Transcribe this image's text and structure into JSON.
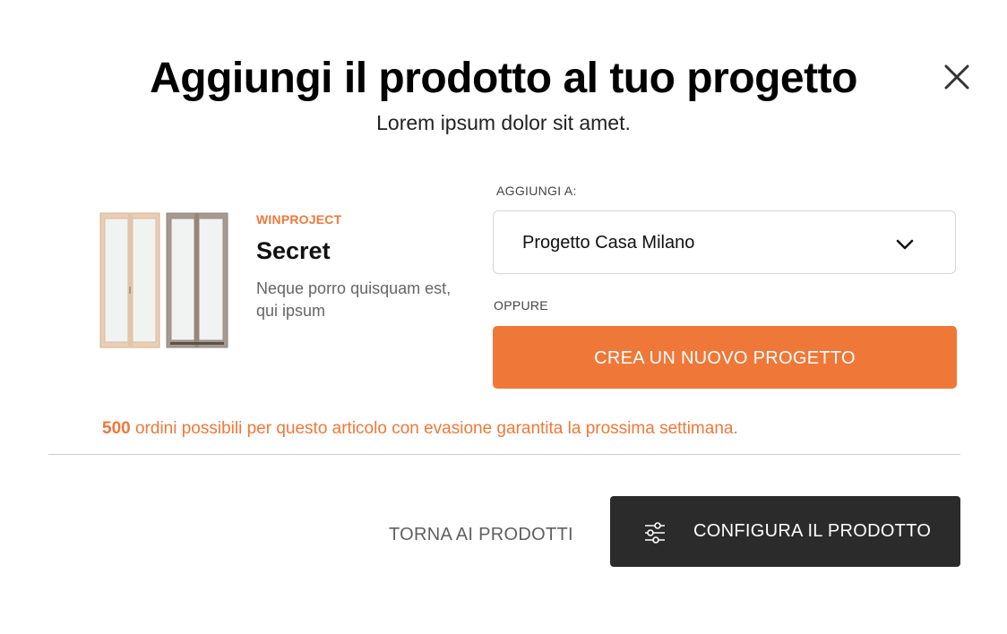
{
  "modal": {
    "title": "Aggiungi il prodotto al tuo progetto",
    "subtitle": "Lorem ipsum dolor sit amet."
  },
  "product": {
    "brand": "WINPROJECT",
    "name": "Secret",
    "description": "Neque porro quisquam est, qui ipsum",
    "image_icon": "window-door-image"
  },
  "project_select": {
    "label": "AGGIUNGI A:",
    "selected_value": "Progetto Casa Milano",
    "icon": "chevron-down-icon"
  },
  "alternative": {
    "label": "OPPURE",
    "create_button_label": "CREA UN NUOVO PROGETTO"
  },
  "availability": {
    "count": "500",
    "message": " ordini possibili per questo articolo con evasione garantita la prossima settimana."
  },
  "footer": {
    "back_label": "TORNA AI PRODOTTI",
    "configure_label": "CONFIGURA IL PRODOTTO",
    "configure_icon": "sliders-icon"
  },
  "colors": {
    "accent": "#ef7839",
    "dark_button": "#2b2b2b"
  }
}
